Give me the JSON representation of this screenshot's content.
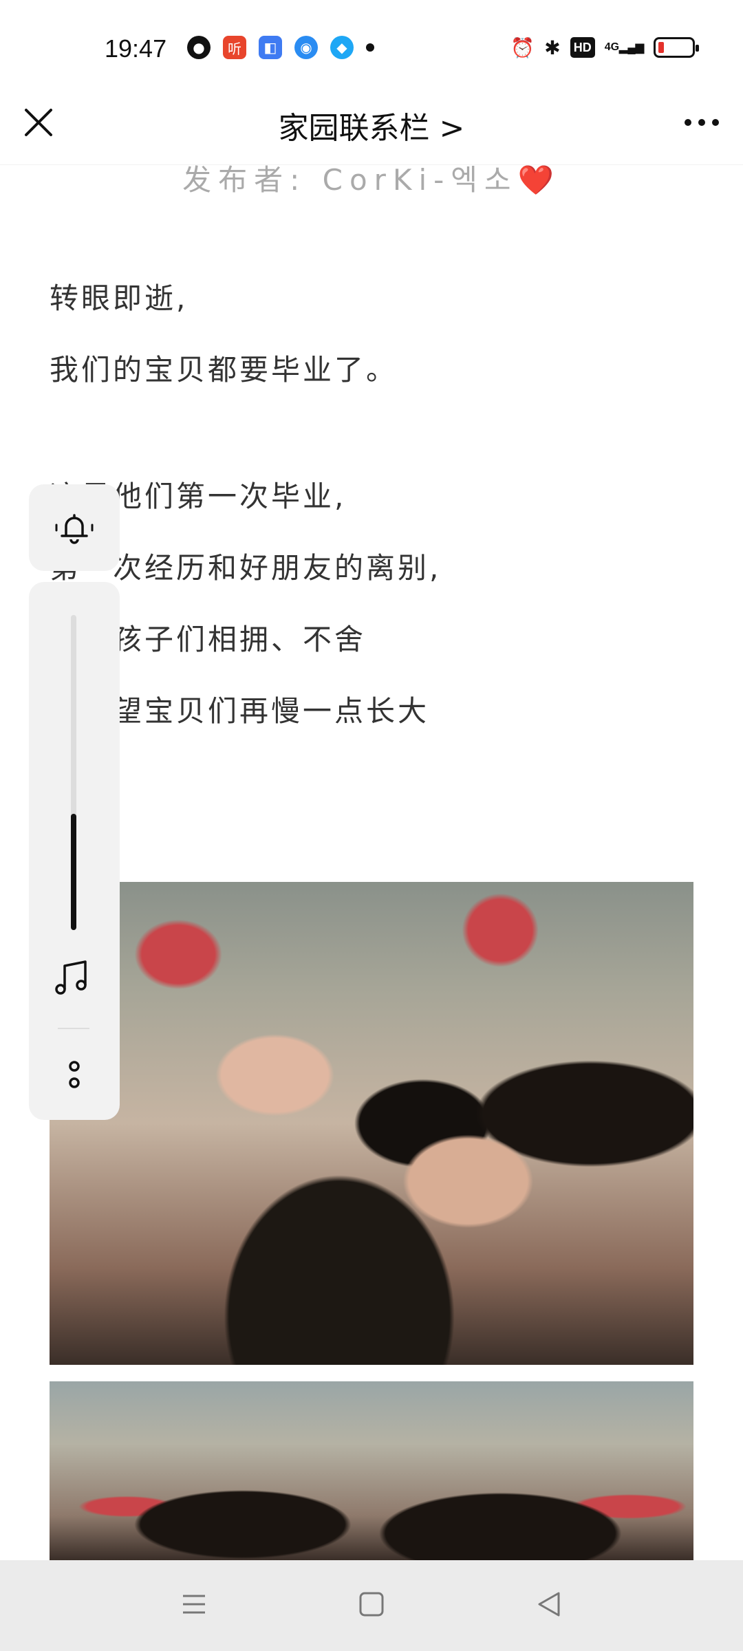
{
  "status_bar": {
    "time": "19:47",
    "app_icons": [
      "q-browser-icon",
      "ting-icon",
      "multitask-icon",
      "dot-app-icon",
      "qq-icon"
    ],
    "ting_label": "听",
    "hd_label": "HD",
    "signal_label": "4G",
    "battery_level": 0.1,
    "battery_color": "#e4312b"
  },
  "nav": {
    "title": "家园联系栏 >"
  },
  "article": {
    "publisher": "发布者: CorKi-엑소❤️",
    "paragraphs": [
      "转眼即逝,",
      "我们的宝贝都要毕业了。",
      "这是他们第一次毕业,",
      "第一次经历和好朋友的离别,",
      "看着孩子们相拥、不舍",
      "多希望宝贝们再慢一点长大"
    ],
    "photos": [
      "graduation-photo-1",
      "graduation-photo-2"
    ]
  },
  "floating_panel": {
    "volume_level": 0.37,
    "icons": [
      "bell-icon",
      "music-note-icon",
      "options-icon"
    ]
  },
  "colors": {
    "text": "#333333",
    "publisher": "#aaaaaa",
    "panel_bg": "#f2f2f2",
    "bottom_nav_bg": "#ebebeb"
  }
}
